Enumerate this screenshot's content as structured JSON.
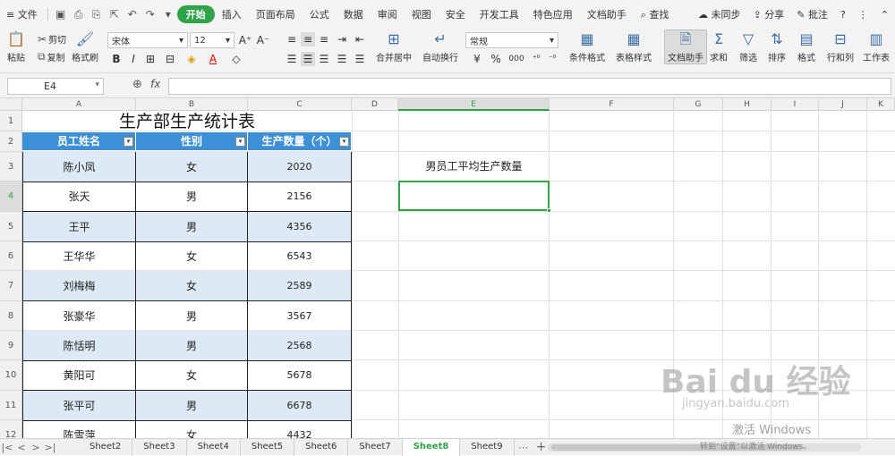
{
  "menubar": {
    "menu_label": "≡ 文件",
    "tabs": [
      "开始",
      "插入",
      "页面布局",
      "公式",
      "数据",
      "审阅",
      "视图",
      "安全",
      "开发工具",
      "特色应用",
      "文档助手",
      "查找"
    ],
    "right": {
      "sync": "未同步",
      "share": "分享",
      "comment": "批注",
      "help": "?"
    }
  },
  "ribbon": {
    "paste": "粘贴",
    "cut": "剪切",
    "copy": "复制",
    "format_painter": "格式刷",
    "font_name": "宋体",
    "font_size": "12",
    "merge_center": "合并居中",
    "wrap_text": "自动换行",
    "number_format": "常规",
    "percent": "%",
    "thousands": "000",
    "conditional_format": "条件格式",
    "table_style": "表格样式",
    "doc_assistant": "文档助手",
    "sum": "求和",
    "filter": "筛选",
    "sort": "排序",
    "format": "格式",
    "row_col": "行和列",
    "worksheet": "工作表"
  },
  "formula_bar": {
    "cell_ref": "E4",
    "fx": "fx",
    "content": ""
  },
  "columns": [
    "A",
    "B",
    "C",
    "D",
    "E",
    "F",
    "G",
    "H",
    "I",
    "J",
    "K"
  ],
  "rows": [
    "1",
    "2",
    "3",
    "4",
    "5",
    "6",
    "7",
    "8",
    "9",
    "10",
    "11",
    "12"
  ],
  "table": {
    "title": "生产部生产统计表",
    "headers": [
      "员工姓名",
      "性别",
      "生产数量（个）"
    ],
    "rows": [
      [
        "陈小凤",
        "女",
        "2020"
      ],
      [
        "张天",
        "男",
        "2156"
      ],
      [
        "王平",
        "男",
        "4356"
      ],
      [
        "王华华",
        "女",
        "6543"
      ],
      [
        "刘梅梅",
        "女",
        "2589"
      ],
      [
        "张豪华",
        "男",
        "3567"
      ],
      [
        "陈恬明",
        "男",
        "2568"
      ],
      [
        "黄阳可",
        "女",
        "5678"
      ],
      [
        "张平可",
        "男",
        "6678"
      ],
      [
        "陈雪萍",
        "女",
        "4432"
      ]
    ]
  },
  "label_cell": "男员工平均生产数量",
  "sheets": [
    "Sheet2",
    "Sheet3",
    "Sheet4",
    "Sheet5",
    "Sheet6",
    "Sheet7",
    "Sheet8",
    "Sheet9"
  ],
  "active_sheet": "Sheet8",
  "watermark": {
    "baidu": "Bai du 经验",
    "url": "jingyan.baidu.com",
    "activate": "激活 Windows",
    "activate_sub": "转到“设置”以激活 Windows。"
  },
  "colors": {
    "accent": "#2fa24a",
    "header_blue": "#3d8fd6",
    "band": "#dde9f5"
  }
}
